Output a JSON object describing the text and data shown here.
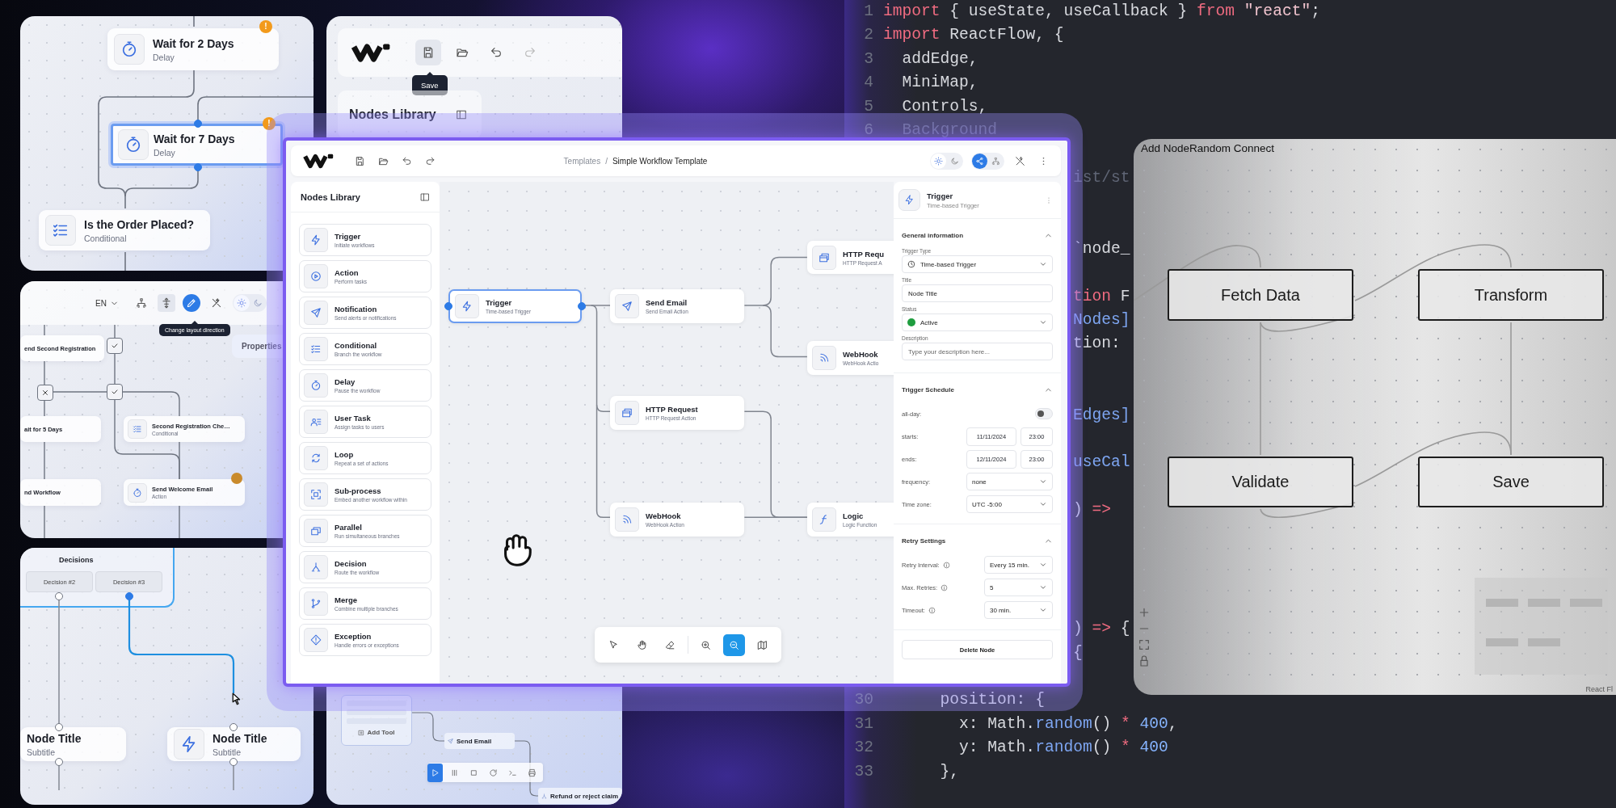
{
  "flow_top": {
    "nodes": [
      {
        "title": "Wait for 2 Days",
        "subtitle": "Delay",
        "selected": false,
        "badge": "!"
      },
      {
        "title": "Wait for 7 Days",
        "subtitle": "Delay",
        "selected": true,
        "badge": "!"
      },
      {
        "title": "Is the Order Placed?",
        "subtitle": "Conditional",
        "selected": false
      }
    ]
  },
  "editor_top": {
    "tooltip": "Save",
    "sidebar_title": "Nodes Library"
  },
  "flow_middle": {
    "language": "EN",
    "tooltip": "Change layout direction",
    "properties_title": "Properties",
    "layout_tools": [
      {
        "selected": false
      },
      {
        "selected": false
      },
      {
        "selected": true
      },
      {
        "selected": false
      }
    ],
    "nodes": [
      {
        "title": "end Second Registration"
      },
      {
        "title": "ait for 5 Days"
      },
      {
        "title": "Second Registration Che…",
        "subtitle": "Conditional"
      },
      {
        "title": "nd Workflow"
      },
      {
        "title": "Send Welcome Email",
        "subtitle": "Action",
        "alert": true
      }
    ]
  },
  "flow_bottom": {
    "group_title": "Decisions",
    "decisions": [
      "Decision #2",
      "Decision #3"
    ],
    "nodes": [
      {
        "title": "Node Title",
        "subtitle": "Subtitle"
      },
      {
        "title": "Node Title",
        "subtitle": "Subtitle"
      }
    ]
  },
  "editor_bottom": {
    "add_button": "Add Tool",
    "nodes": [
      {
        "title": "Send Email"
      },
      {
        "title": "Refund or reject claim"
      }
    ],
    "player": [
      {
        "selected": true
      },
      {
        "selected": false
      },
      {
        "selected": false
      },
      {
        "selected": false
      },
      {
        "selected": false
      },
      {
        "selected": false
      }
    ]
  },
  "main_window": {
    "breadcrumb": [
      "Templates",
      "Simple Workflow Template"
    ],
    "breadcrumb_separator": "/",
    "theme": [
      {
        "selected": true
      },
      {
        "selected": false
      }
    ],
    "mode": [
      {
        "selected": true
      },
      {
        "selected": false
      }
    ],
    "sidebar": {
      "title": "Nodes Library",
      "items": [
        {
          "title": "Trigger",
          "subtitle": "Initiate workflows"
        },
        {
          "title": "Action",
          "subtitle": "Perform tasks"
        },
        {
          "title": "Notification",
          "subtitle": "Send alerts or notifications"
        },
        {
          "title": "Conditional",
          "subtitle": "Branch the workflow"
        },
        {
          "title": "Delay",
          "subtitle": "Pause the workflow"
        },
        {
          "title": "User Task",
          "subtitle": "Assign tasks to users"
        },
        {
          "title": "Loop",
          "subtitle": "Repeat a set of actions"
        },
        {
          "title": "Sub-process",
          "subtitle": "Embed another workflow within"
        },
        {
          "title": "Parallel",
          "subtitle": "Run simultaneous branches"
        },
        {
          "title": "Decision",
          "subtitle": "Route the workflow"
        },
        {
          "title": "Merge",
          "subtitle": "Combine multiple branches"
        },
        {
          "title": "Exception",
          "subtitle": "Handle errors or exceptions"
        }
      ]
    },
    "canvas": {
      "nodes": [
        {
          "title": "Trigger",
          "subtitle": "Time-based Trigger",
          "selected": true
        },
        {
          "title": "Send Email",
          "subtitle": "Send Email Action",
          "selected": false
        },
        {
          "title": "HTTP Requ",
          "subtitle": "HTTP Request A",
          "selected": false
        },
        {
          "title": "WebHook",
          "subtitle": "WebHook Actio",
          "selected": false
        },
        {
          "title": "HTTP Request",
          "subtitle": "HTTP Request Action",
          "selected": false
        },
        {
          "title": "WebHook",
          "subtitle": "WebHook Action",
          "selected": false
        },
        {
          "title": "Logic",
          "subtitle": "Logic Function",
          "selected": false
        }
      ],
      "tools": [
        {
          "selected": false
        },
        {
          "selected": false
        },
        {
          "selected": false
        },
        {
          "selected": false
        },
        {
          "selected": true
        },
        {
          "selected": false
        }
      ]
    },
    "properties": {
      "title": "Trigger",
      "subtitle": "Time-based Trigger",
      "sections": [
        {
          "title": "General information",
          "expanded": true,
          "fields": [
            {
              "kind": "select",
              "label": "Trigger Type",
              "value": "Time-based Trigger"
            },
            {
              "kind": "text",
              "label": "Title",
              "value": "Node Title"
            },
            {
              "kind": "status",
              "label": "Status",
              "value": "Active",
              "color": "#1f9d3f"
            },
            {
              "kind": "text",
              "label": "Description",
              "placeholder": "Type your description here..."
            }
          ]
        },
        {
          "title": "Trigger Schedule",
          "expanded": true,
          "fields": [
            {
              "kind": "toggle",
              "label": "all-day:",
              "on": false
            },
            {
              "kind": "datetime",
              "label": "starts:",
              "date": "11/11/2024",
              "time": "23:00"
            },
            {
              "kind": "datetime",
              "label": "ends:",
              "date": "12/11/2024",
              "time": "23:00"
            },
            {
              "kind": "row_select",
              "label": "frequency:",
              "value": "none"
            },
            {
              "kind": "row_select",
              "label": "Time zone:",
              "value": "UTC -5:00"
            }
          ]
        },
        {
          "title": "Retry Settings",
          "expanded": true,
          "fields": [
            {
              "kind": "info_select",
              "label": "Retry Interval:",
              "value": "Every 15 min."
            },
            {
              "kind": "info_select",
              "label": "Max. Retries:",
              "value": "5"
            },
            {
              "kind": "info_select",
              "label": "Timeout:",
              "value": "30 min."
            }
          ]
        }
      ],
      "delete_button": "Delete Node"
    }
  },
  "code_editor": {
    "lines": [
      {
        "kind": "code",
        "number": "1",
        "tokens": [
          {
            "kind": "kw",
            "text": "import"
          },
          {
            "kind": "pl",
            "text": " { useState, useCallback } "
          },
          {
            "kind": "kw",
            "text": "from"
          },
          {
            "kind": "str",
            "text": " \"react\""
          },
          {
            "kind": "pl",
            "text": ";"
          }
        ]
      },
      {
        "kind": "code",
        "number": "2",
        "tokens": [
          {
            "kind": "kw",
            "text": "import"
          },
          {
            "kind": "pl",
            "text": " ReactFlow, {"
          }
        ]
      },
      {
        "kind": "code",
        "number": "3",
        "tokens": [
          {
            "kind": "pl",
            "text": "  addEdge,"
          }
        ]
      },
      {
        "kind": "code",
        "number": "4",
        "tokens": [
          {
            "kind": "pl",
            "text": "  MiniMap,"
          }
        ]
      },
      {
        "kind": "code",
        "number": "5",
        "tokens": [
          {
            "kind": "pl",
            "text": "  Controls,"
          }
        ]
      },
      {
        "kind": "code",
        "number": "6",
        "tokens": [
          {
            "kind": "dim",
            "text": "  Background"
          }
        ]
      },
      {
        "kind": "blank"
      },
      {
        "kind": "fragment",
        "tokens": [
          {
            "kind": "dim",
            "text": "ist/st"
          }
        ]
      },
      {
        "kind": "blank"
      },
      {
        "kind": "blank"
      },
      {
        "kind": "fragment",
        "tokens": [
          {
            "kind": "pl",
            "text": "`node_"
          }
        ]
      },
      {
        "kind": "blank"
      },
      {
        "kind": "fragment",
        "tokens": [
          {
            "kind": "kw",
            "text": "tion"
          },
          {
            "kind": "pl",
            "text": " F"
          }
        ]
      },
      {
        "kind": "fragment",
        "tokens": [
          {
            "kind": "fn",
            "text": "Nodes]"
          }
        ]
      },
      {
        "kind": "fragment",
        "tokens": [
          {
            "kind": "pl",
            "text": "tion:"
          }
        ]
      },
      {
        "kind": "blank"
      },
      {
        "kind": "blank"
      },
      {
        "kind": "fragment",
        "tokens": [
          {
            "kind": "fn",
            "text": "Edges]"
          }
        ]
      },
      {
        "kind": "blank"
      },
      {
        "kind": "fragment",
        "tokens": [
          {
            "kind": "fn",
            "text": "useCal"
          }
        ]
      },
      {
        "kind": "blank"
      },
      {
        "kind": "fragment",
        "tokens": [
          {
            "kind": "pl",
            "text": ")"
          },
          {
            "kind": "kw",
            "text": " =>"
          }
        ]
      },
      {
        "kind": "blank"
      },
      {
        "kind": "blank"
      },
      {
        "kind": "blank"
      },
      {
        "kind": "blank"
      },
      {
        "kind": "fragment",
        "tokens": [
          {
            "kind": "pl",
            "text": ")"
          },
          {
            "kind": "kw",
            "text": " =>"
          },
          {
            "kind": "pl",
            "text": " {"
          }
        ]
      },
      {
        "kind": "fragment",
        "tokens": [
          {
            "kind": "pl",
            "text": "{"
          }
        ]
      },
      {
        "kind": "blank"
      },
      {
        "kind": "code",
        "number": "30",
        "tokens": [
          {
            "kind": "pl",
            "text": "      position: {"
          }
        ]
      },
      {
        "kind": "code",
        "number": "31",
        "tokens": [
          {
            "kind": "pl",
            "text": "        x: Math."
          },
          {
            "kind": "fn",
            "text": "random"
          },
          {
            "kind": "pl",
            "text": "() "
          },
          {
            "kind": "kw",
            "text": "*"
          },
          {
            "kind": "num",
            "text": " 400"
          },
          {
            "kind": "pl",
            "text": ","
          }
        ]
      },
      {
        "kind": "code",
        "number": "32",
        "tokens": [
          {
            "kind": "pl",
            "text": "        y: Math."
          },
          {
            "kind": "fn",
            "text": "random"
          },
          {
            "kind": "pl",
            "text": "() "
          },
          {
            "kind": "kw",
            "text": "*"
          },
          {
            "kind": "num",
            "text": " 400"
          }
        ]
      },
      {
        "kind": "code",
        "number": "33",
        "tokens": [
          {
            "kind": "pl",
            "text": "      },"
          }
        ]
      }
    ]
  },
  "react_flow": {
    "toolbar": "Add NodeRandom Connect",
    "nodes": [
      {
        "label": "Fetch Data"
      },
      {
        "label": "Transform"
      },
      {
        "label": "Validate"
      },
      {
        "label": "Save"
      }
    ],
    "attribution": "React Fl"
  }
}
